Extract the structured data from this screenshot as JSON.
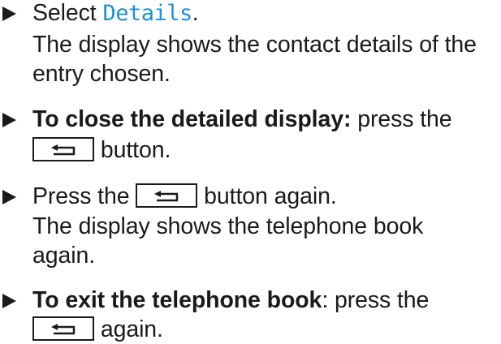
{
  "steps": [
    {
      "select_prefix": "Select ",
      "select_value": "Details",
      "select_suffix": ".",
      "result_line1": "The display shows the contact details of the",
      "result_line2": "entry chosen."
    },
    {
      "title": "To close the detailed display:",
      "action_line1": " press the",
      "action_after_key": " button."
    },
    {
      "prefix": "Press the ",
      "suffix": " button again.",
      "result_line1": "The display shows the telephone book",
      "result_line2": "again."
    },
    {
      "title": "To exit the telephone book",
      "action_line1": ": press the",
      "action_after_key": " again."
    }
  ],
  "icons": {
    "bullet": "triangle-right-icon",
    "back_key": "back-arrow-icon"
  },
  "colors": {
    "text": "#1a1a1a",
    "highlight": "#1f8fd6"
  }
}
